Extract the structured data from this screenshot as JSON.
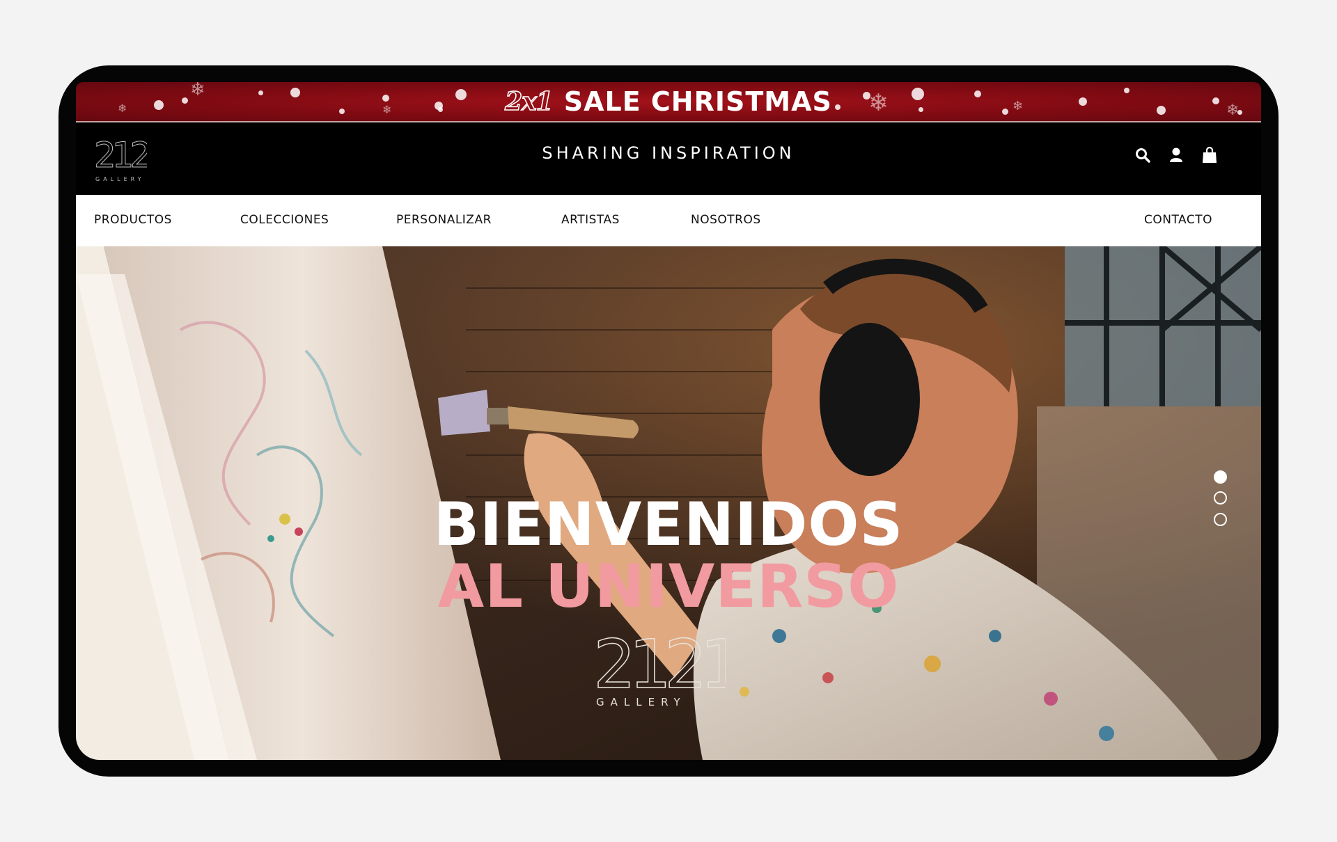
{
  "promo": {
    "prefix": "2x1",
    "label": "SALE CHRISTMAS"
  },
  "header": {
    "logo_number": "2121",
    "logo_word": "GALLERY",
    "tagline": "SHARING INSPIRATION",
    "icons": [
      "search-icon",
      "user-icon",
      "shopping-bag-icon"
    ]
  },
  "nav": {
    "items": [
      {
        "label": "PRODUCTOS"
      },
      {
        "label": "COLECCIONES"
      },
      {
        "label": "PERSONALIZAR"
      },
      {
        "label": "ARTISTAS"
      },
      {
        "label": "NOSOTROS"
      },
      {
        "label": "CONTACTO"
      }
    ]
  },
  "hero": {
    "title_line1": "BIENVENIDOS",
    "title_line2": "AL UNIVERSO",
    "logo_number": "2121",
    "logo_word": "GALLERY",
    "slides": 3,
    "active_slide": 1
  },
  "colors": {
    "promo_red": "#8a0c14",
    "header_black": "#000000",
    "accent_pink": "#f19aa0",
    "page_bg": "#f3f3f3"
  }
}
